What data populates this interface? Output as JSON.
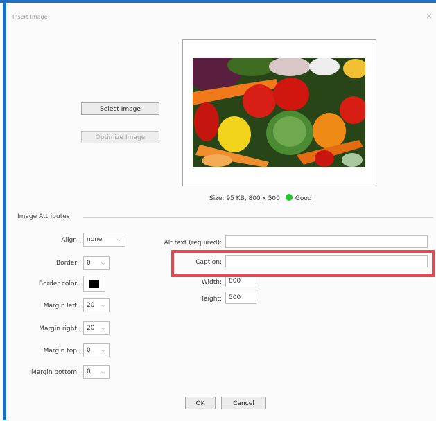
{
  "dialog": {
    "title": "Insert Image",
    "close_glyph": "×"
  },
  "buttons": {
    "select_image": "Select Image",
    "optimize_image": "Optimize Image",
    "ok": "OK",
    "cancel": "Cancel"
  },
  "preview": {
    "size_text": "Size: 95 KB, 800 x 500",
    "status": "Good",
    "status_color": "#22c42c"
  },
  "attributes": {
    "section_title": "Image Attributes",
    "align": {
      "label": "Align:",
      "value": "none"
    },
    "border": {
      "label": "Border:",
      "value": "0"
    },
    "border_color": {
      "label": "Border color:",
      "value": "#000000"
    },
    "margin_left": {
      "label": "Margin left:",
      "value": "20"
    },
    "margin_right": {
      "label": "Margin right:",
      "value": "20"
    },
    "margin_top": {
      "label": "Margin top:",
      "value": "0"
    },
    "margin_bottom": {
      "label": "Margin bottom:",
      "value": "0"
    },
    "alt_text": {
      "label": "Alt text (required):",
      "value": ""
    },
    "caption": {
      "label": "Caption:",
      "value": ""
    },
    "width": {
      "label": "Width:",
      "value": "800"
    },
    "height": {
      "label": "Height:",
      "value": "500"
    }
  },
  "icons": {
    "dropdown": "chevron-down-icon",
    "close": "close-icon"
  },
  "accent": {
    "frame": "#1f6fc0",
    "highlight": "#e5484f"
  }
}
